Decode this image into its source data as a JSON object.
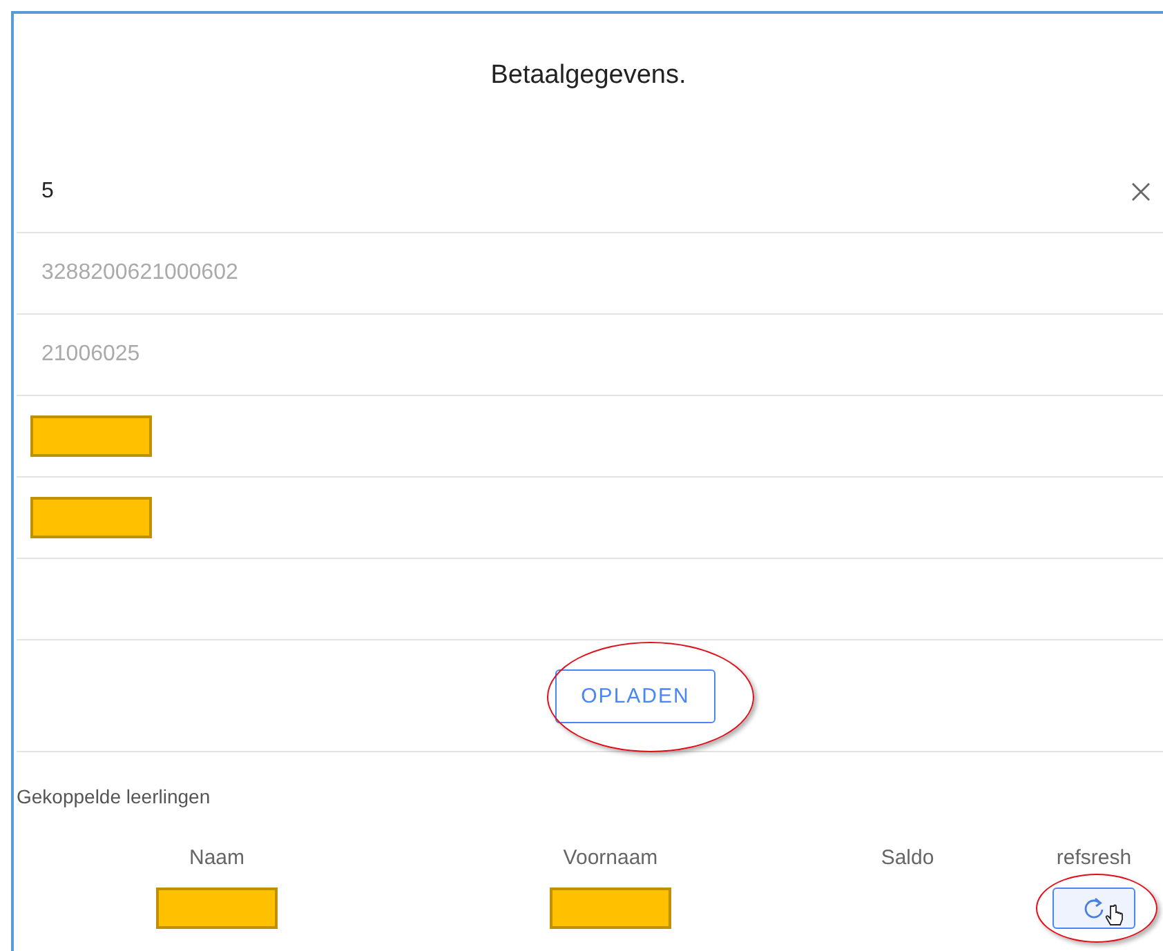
{
  "title": "Betaalgegevens.",
  "fields": [
    {
      "kind": "input",
      "value": "5",
      "clearable": true
    },
    {
      "kind": "input",
      "placeholder": "3288200621000602"
    },
    {
      "kind": "input",
      "placeholder": "21006025"
    },
    {
      "kind": "redacted"
    },
    {
      "kind": "redacted"
    },
    {
      "kind": "empty"
    }
  ],
  "upload_button": {
    "label": "OPLADEN",
    "highlighted": true
  },
  "linked_section": {
    "label": "Gekoppelde leerlingen",
    "columns": [
      "Naam",
      "Voornaam",
      "Saldo",
      "refsresh"
    ],
    "rows": [
      {
        "cells": [
          {
            "kind": "redacted"
          },
          {
            "kind": "redacted"
          },
          {
            "kind": "empty"
          },
          {
            "kind": "refresh",
            "highlighted": true,
            "cursor": true
          }
        ]
      }
    ]
  }
}
